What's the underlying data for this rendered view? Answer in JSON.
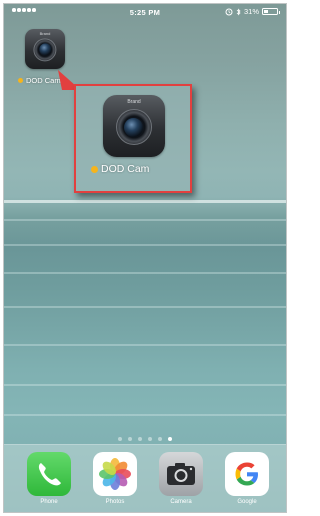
{
  "status_bar": {
    "time": "5:25 PM",
    "battery": "31%",
    "battery_level": 0.31
  },
  "home": {
    "small_app_label": "DOD Cam",
    "highlight_app_label": "DOD Cam",
    "app_icon_brand": "Brand",
    "page_count": 6,
    "active_page": 6
  },
  "dock": {
    "apps": [
      {
        "label": "Phone",
        "icon": "phone-icon"
      },
      {
        "label": "Photos",
        "icon": "photos-icon"
      },
      {
        "label": "Camera",
        "icon": "camera-icon"
      },
      {
        "label": "Google",
        "icon": "google-icon"
      }
    ]
  },
  "colors": {
    "highlight_border": "#e2403f",
    "notification_dot": "#f6b41c"
  }
}
